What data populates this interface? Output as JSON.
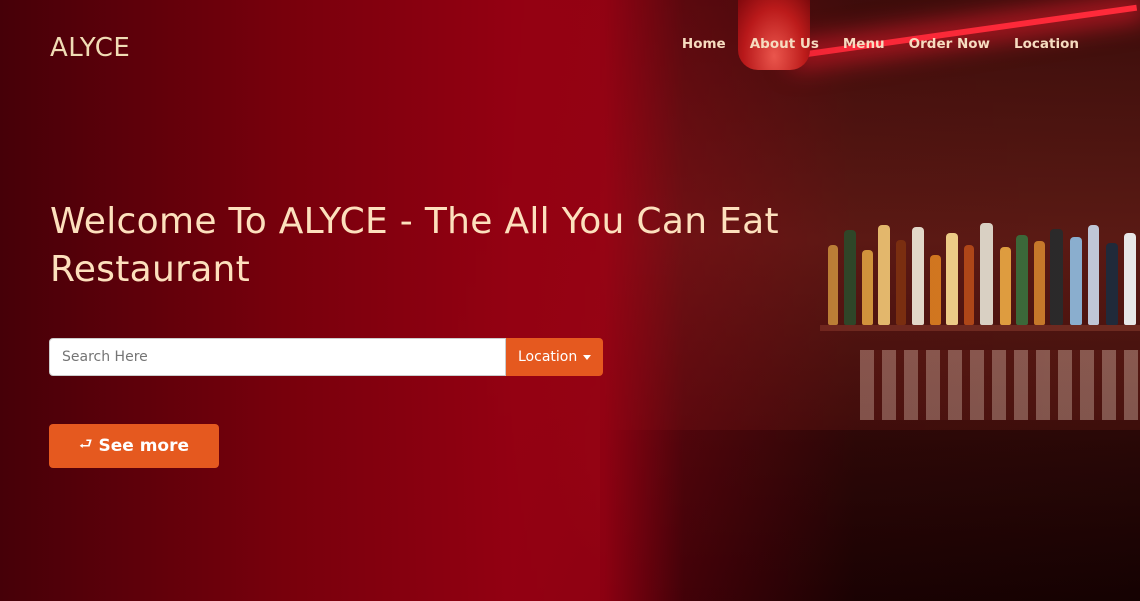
{
  "brand": "ALYCE",
  "nav": {
    "home": "Home",
    "about": "About Us",
    "menu": "Menu",
    "order": "Order Now",
    "location": "Location"
  },
  "hero": {
    "headline": "Welcome To ALYCE - The All You Can Eat Restaurant",
    "search_placeholder": "Search Here",
    "location_button": "Location",
    "see_more_button": "See more",
    "see_more_icon": "arrow-down-icon"
  },
  "colors": {
    "accent": "#e5591f",
    "headline_text": "#fde0bd",
    "overlay_red": "#9a0012"
  },
  "background_image": "restaurant bar with bottles and red neon lighting"
}
